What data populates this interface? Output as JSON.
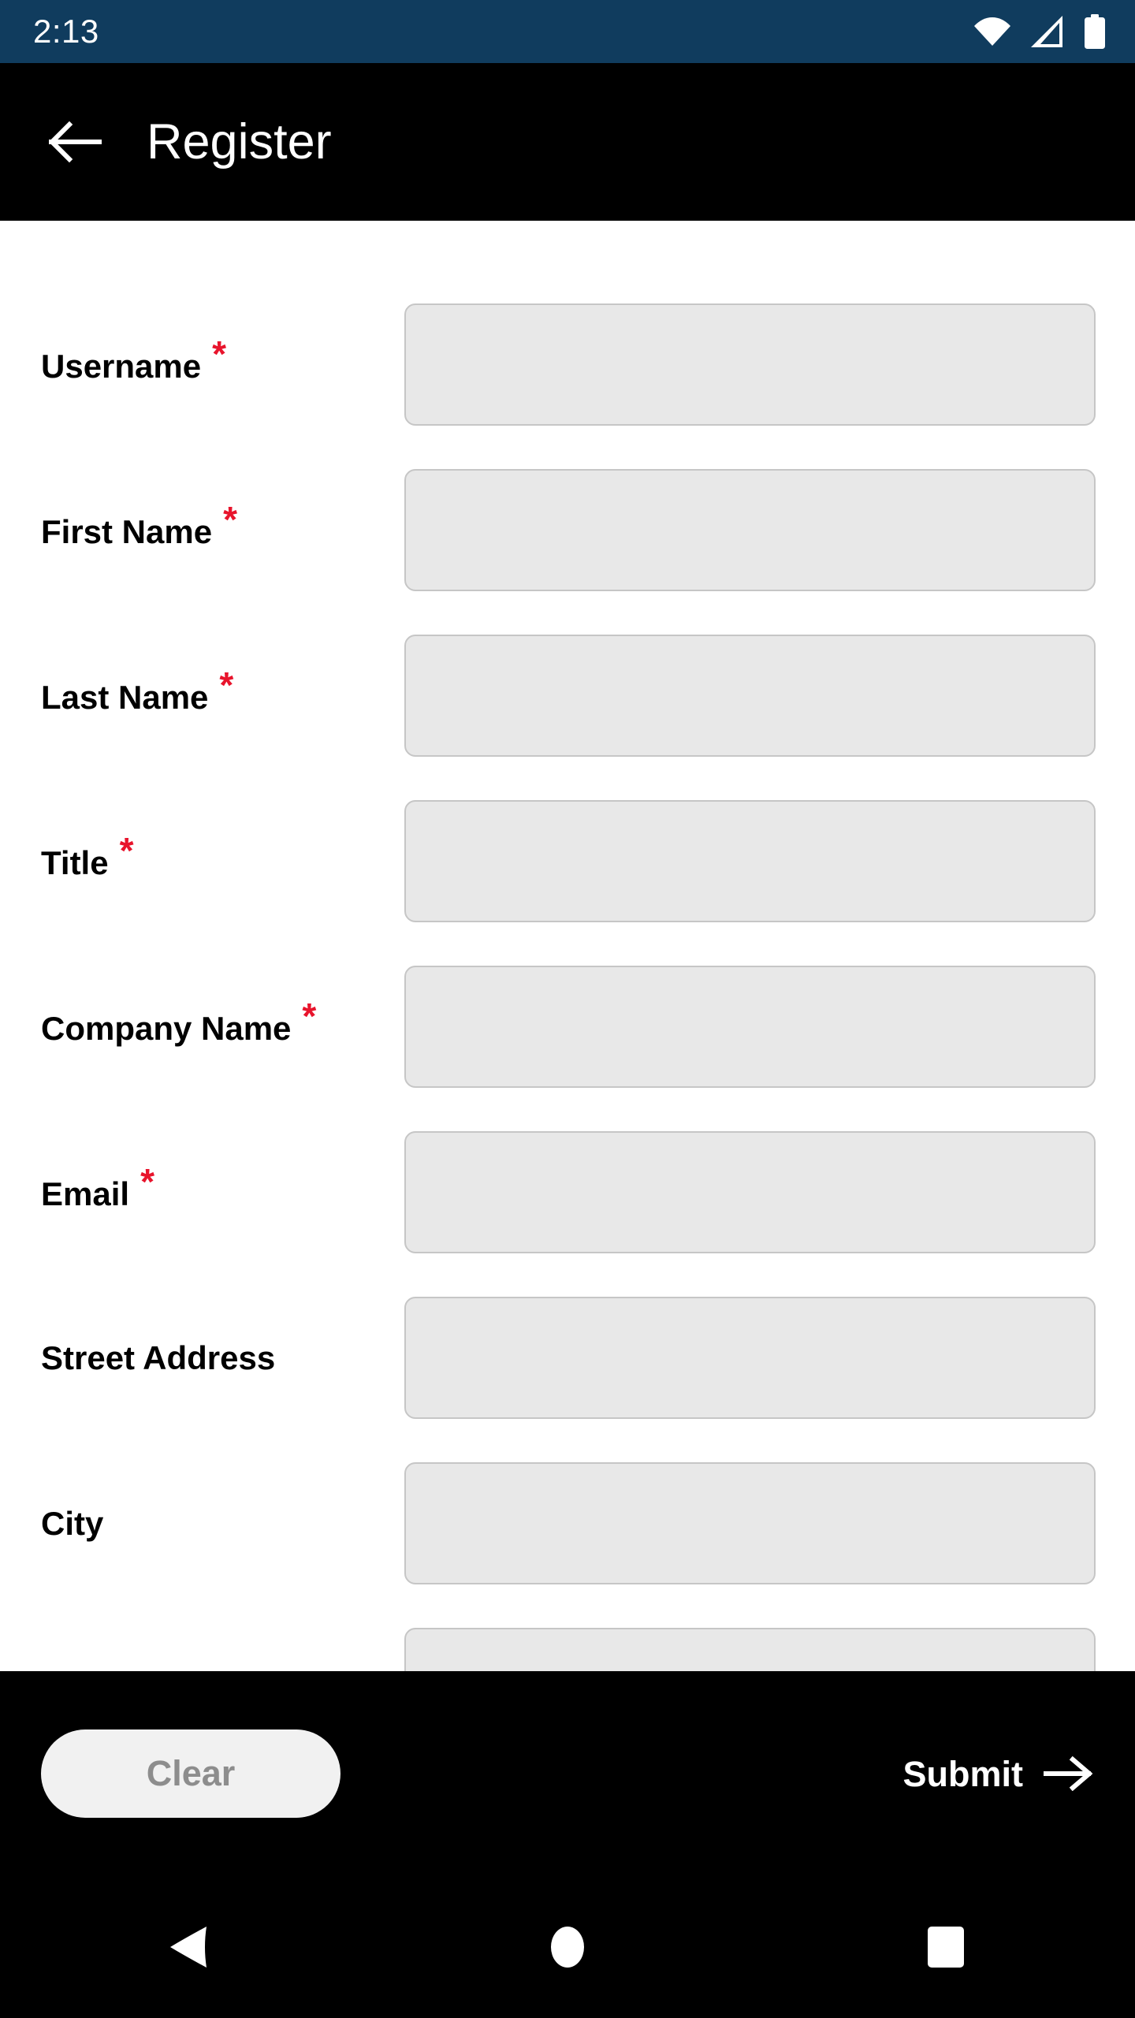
{
  "status_bar": {
    "clock": "2:13",
    "background": "#103c5e",
    "icons": [
      "wifi-icon",
      "cellular-signal-icon",
      "battery-icon"
    ]
  },
  "app_bar": {
    "title": "Register",
    "back_icon": "arrow-left-icon",
    "background": "#000000",
    "text_color": "#ffffff"
  },
  "form": {
    "required_marker": "*",
    "required_marker_color": "#e8142c",
    "field_background": "#e8e8e8",
    "fields": [
      {
        "label": "Username",
        "required": true,
        "value": "",
        "placeholder": ""
      },
      {
        "label": "First Name",
        "required": true,
        "value": "",
        "placeholder": ""
      },
      {
        "label": "Last Name",
        "required": true,
        "value": "",
        "placeholder": ""
      },
      {
        "label": "Title",
        "required": true,
        "value": "",
        "placeholder": ""
      },
      {
        "label": "Company Name",
        "required": true,
        "value": "",
        "placeholder": ""
      },
      {
        "label": "Email",
        "required": true,
        "value": "",
        "placeholder": ""
      },
      {
        "label": "Street Address",
        "required": false,
        "value": "",
        "placeholder": ""
      },
      {
        "label": "City",
        "required": false,
        "value": "",
        "placeholder": ""
      },
      {
        "label": "",
        "required": false,
        "value": "",
        "placeholder": ""
      }
    ]
  },
  "footer": {
    "clear_label": "Clear",
    "clear_text_color": "#8d8d8d",
    "submit_label": "Submit",
    "submit_icon": "arrow-right-icon",
    "background": "#000000"
  },
  "nav_bar": {
    "items": [
      {
        "name": "back",
        "icon": "triangle-back-icon"
      },
      {
        "name": "home",
        "icon": "circle-home-icon"
      },
      {
        "name": "recents",
        "icon": "square-recents-icon"
      }
    ]
  }
}
